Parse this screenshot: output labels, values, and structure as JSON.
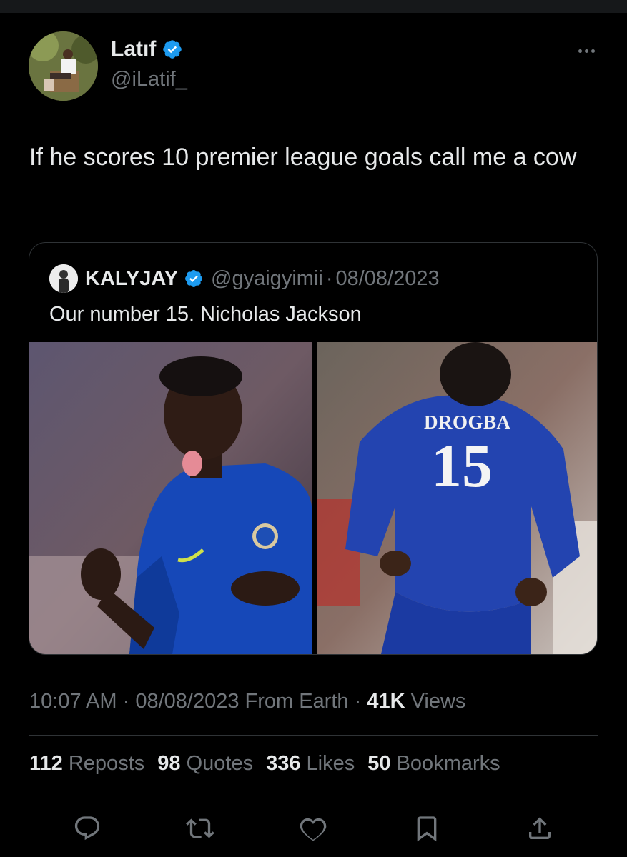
{
  "author": {
    "name": "Latıf",
    "handle": "@iLatif_"
  },
  "tweet": {
    "text": "If he scores 10 premier league goals call me a cow"
  },
  "quoted": {
    "name": "KALYJAY",
    "handle": "@gyaigyimii",
    "separator": "·",
    "date": "08/08/2023",
    "text": "Our number 15. Nicholas Jackson",
    "jersey_name": "DROGBA",
    "jersey_number": "15"
  },
  "meta": {
    "time": "10:07 AM",
    "separator1": " · ",
    "date": "08/08/2023",
    "source": " From Earth",
    "separator2": " · ",
    "views_count": "41K",
    "views_label": " Views"
  },
  "stats": {
    "reposts_count": "112",
    "reposts_label": "Reposts",
    "quotes_count": "98",
    "quotes_label": "Quotes",
    "likes_count": "336",
    "likes_label": "Likes",
    "bookmarks_count": "50",
    "bookmarks_label": "Bookmarks"
  },
  "icons": {
    "verified": "verified-badge-icon",
    "more": "more-icon",
    "reply": "reply-icon",
    "repost": "repost-icon",
    "like": "like-icon",
    "bookmark": "bookmark-icon",
    "share": "share-icon"
  },
  "colors": {
    "background": "#000000",
    "text_primary": "#e7e9ea",
    "text_secondary": "#71767b",
    "verified_blue": "#1d9bf0",
    "border": "#2f3336"
  }
}
